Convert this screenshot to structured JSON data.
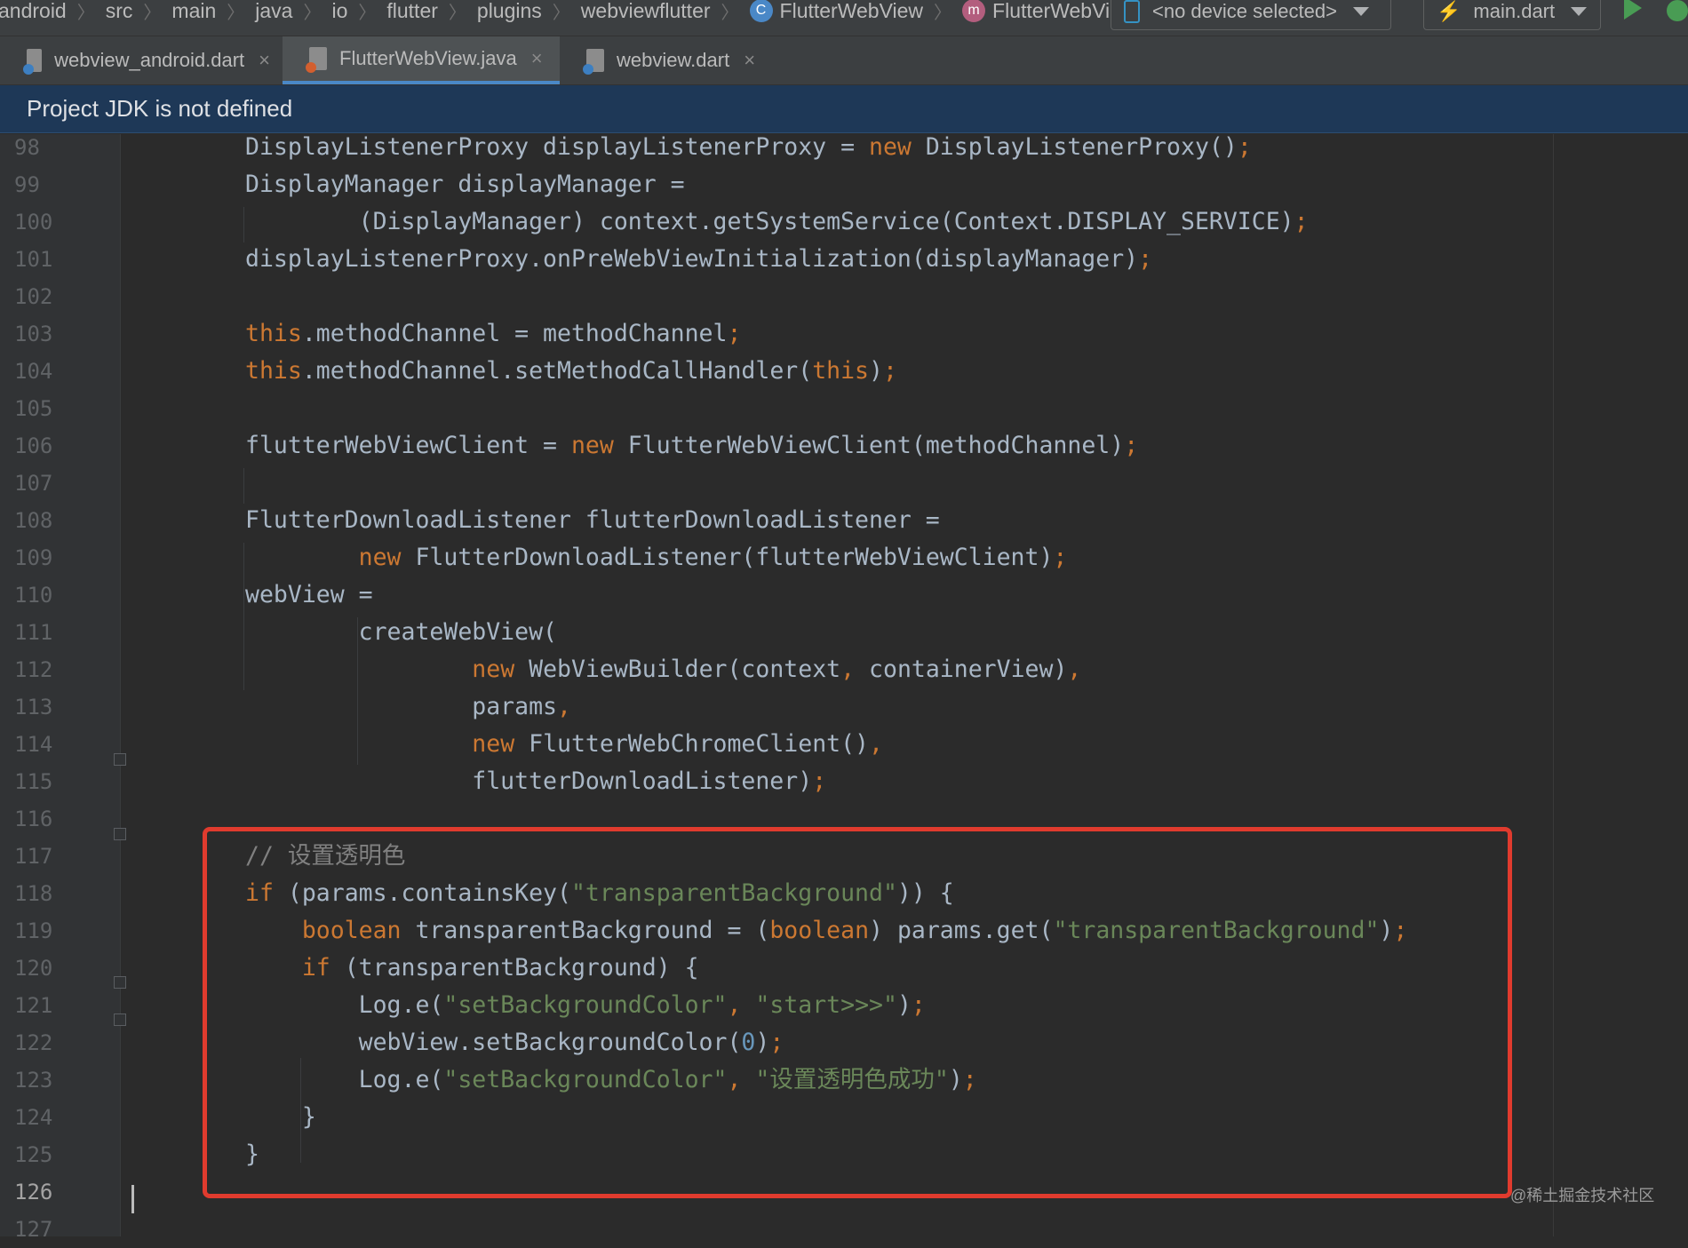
{
  "breadcrumb": {
    "items": [
      "android",
      "src",
      "main",
      "java",
      "io",
      "flutter",
      "plugins",
      "webviewflutter"
    ],
    "class_badge": "C",
    "class_name": "FlutterWebView",
    "method_badge": "m",
    "method_name": "FlutterWebView"
  },
  "toolbar": {
    "device_selector": "<no device selected>",
    "run_config": "main.dart"
  },
  "tabs": [
    {
      "label": "webview_android.dart",
      "active": false,
      "icon": "dart-file-icon"
    },
    {
      "label": "FlutterWebView.java",
      "active": true,
      "icon": "java-file-icon"
    },
    {
      "label": "webview.dart",
      "active": false,
      "icon": "dart-file-icon"
    }
  ],
  "banner": {
    "text": "Project JDK is not defined"
  },
  "editor": {
    "lines": [
      {
        "n": "98",
        "segs": [
          [
            "p",
            "DisplayListenerProxy displayListenerProxy = "
          ],
          [
            "k",
            "new"
          ],
          [
            "p",
            " DisplayListenerProxy()"
          ],
          [
            "k",
            ";"
          ]
        ]
      },
      {
        "n": "99",
        "segs": [
          [
            "p",
            "DisplayManager displayManager ="
          ]
        ]
      },
      {
        "n": "100",
        "segs": [
          [
            "p",
            "        (DisplayManager) context.getSystemService(Context.DISPLAY_SERVICE)"
          ],
          [
            "k",
            ";"
          ]
        ]
      },
      {
        "n": "101",
        "segs": [
          [
            "p",
            "displayListenerProxy.onPreWebViewInitialization(displayManager)"
          ],
          [
            "k",
            ";"
          ]
        ]
      },
      {
        "n": "102",
        "segs": []
      },
      {
        "n": "103",
        "segs": [
          [
            "k",
            "this"
          ],
          [
            "p",
            ".methodChannel = methodChannel"
          ],
          [
            "k",
            ";"
          ]
        ]
      },
      {
        "n": "104",
        "segs": [
          [
            "k",
            "this"
          ],
          [
            "p",
            ".methodChannel.setMethodCallHandler("
          ],
          [
            "k",
            "this"
          ],
          [
            "p",
            ")"
          ],
          [
            "k",
            ";"
          ]
        ]
      },
      {
        "n": "105",
        "segs": []
      },
      {
        "n": "106",
        "segs": [
          [
            "p",
            "flutterWebViewClient = "
          ],
          [
            "k",
            "new"
          ],
          [
            "p",
            " FlutterWebViewClient(methodChannel)"
          ],
          [
            "k",
            ";"
          ]
        ]
      },
      {
        "n": "107",
        "segs": []
      },
      {
        "n": "108",
        "segs": [
          [
            "p",
            "FlutterDownloadListener flutterDownloadListener ="
          ]
        ]
      },
      {
        "n": "109",
        "segs": [
          [
            "p",
            "        "
          ],
          [
            "k",
            "new"
          ],
          [
            "p",
            " FlutterDownloadListener(flutterWebViewClient)"
          ],
          [
            "k",
            ";"
          ]
        ]
      },
      {
        "n": "110",
        "segs": [
          [
            "p",
            "webView ="
          ]
        ]
      },
      {
        "n": "111",
        "segs": [
          [
            "p",
            "        createWebView("
          ]
        ]
      },
      {
        "n": "112",
        "segs": [
          [
            "p",
            "                "
          ],
          [
            "k",
            "new"
          ],
          [
            "p",
            " WebViewBuilder(context"
          ],
          [
            "k",
            ","
          ],
          [
            "p",
            " containerView)"
          ],
          [
            "k",
            ","
          ]
        ]
      },
      {
        "n": "113",
        "segs": [
          [
            "p",
            "                params"
          ],
          [
            "k",
            ","
          ]
        ]
      },
      {
        "n": "114",
        "segs": [
          [
            "p",
            "                "
          ],
          [
            "k",
            "new"
          ],
          [
            "p",
            " FlutterWebChromeClient()"
          ],
          [
            "k",
            ","
          ]
        ]
      },
      {
        "n": "115",
        "segs": [
          [
            "p",
            "                flutterDownloadListener)"
          ],
          [
            "k",
            ";"
          ]
        ]
      },
      {
        "n": "116",
        "segs": []
      },
      {
        "n": "117",
        "segs": [
          [
            "c",
            "// 设置透明色"
          ]
        ]
      },
      {
        "n": "118",
        "segs": [
          [
            "k",
            "if"
          ],
          [
            "p",
            " (params.containsKey("
          ],
          [
            "s",
            "\"transparentBackground\""
          ],
          [
            "p",
            ")) {"
          ]
        ]
      },
      {
        "n": "119",
        "segs": [
          [
            "p",
            "    "
          ],
          [
            "k",
            "boolean"
          ],
          [
            "p",
            " transparentBackground = ("
          ],
          [
            "k",
            "boolean"
          ],
          [
            "p",
            ") params.get("
          ],
          [
            "s",
            "\"transparentBackground\""
          ],
          [
            "p",
            ")"
          ],
          [
            "k",
            ";"
          ]
        ]
      },
      {
        "n": "120",
        "segs": [
          [
            "p",
            "    "
          ],
          [
            "k",
            "if"
          ],
          [
            "p",
            " (transparentBackground) {"
          ]
        ]
      },
      {
        "n": "121",
        "segs": [
          [
            "p",
            "        Log.e("
          ],
          [
            "s",
            "\"setBackgroundColor\""
          ],
          [
            "k",
            ","
          ],
          [
            "p",
            " "
          ],
          [
            "s",
            "\"start>>>\""
          ],
          [
            "p",
            ")"
          ],
          [
            "k",
            ";"
          ]
        ]
      },
      {
        "n": "122",
        "segs": [
          [
            "p",
            "        webView.setBackgroundColor("
          ],
          [
            "n",
            "0"
          ],
          [
            "p",
            ")"
          ],
          [
            "k",
            ";"
          ]
        ]
      },
      {
        "n": "123",
        "segs": [
          [
            "p",
            "        Log.e("
          ],
          [
            "s",
            "\"setBackgroundColor\""
          ],
          [
            "k",
            ","
          ],
          [
            "p",
            " "
          ],
          [
            "s",
            "\"设置透明色成功\""
          ],
          [
            "p",
            ")"
          ],
          [
            "k",
            ";"
          ]
        ]
      },
      {
        "n": "124",
        "segs": [
          [
            "p",
            "    }"
          ]
        ]
      },
      {
        "n": "125",
        "segs": [
          [
            "p",
            "}"
          ]
        ]
      },
      {
        "n": "126",
        "segs": []
      },
      {
        "n": "127",
        "segs": []
      }
    ],
    "current_line": "126"
  },
  "watermark": "@稀土掘金技术社区",
  "colors": {
    "keyword": "#cc7832",
    "string": "#6a8759",
    "number": "#6897bb",
    "comment": "#808080",
    "plain": "#a9b7c6",
    "highlight_box": "#e03b2e",
    "banner_bg": "#1e3857"
  }
}
